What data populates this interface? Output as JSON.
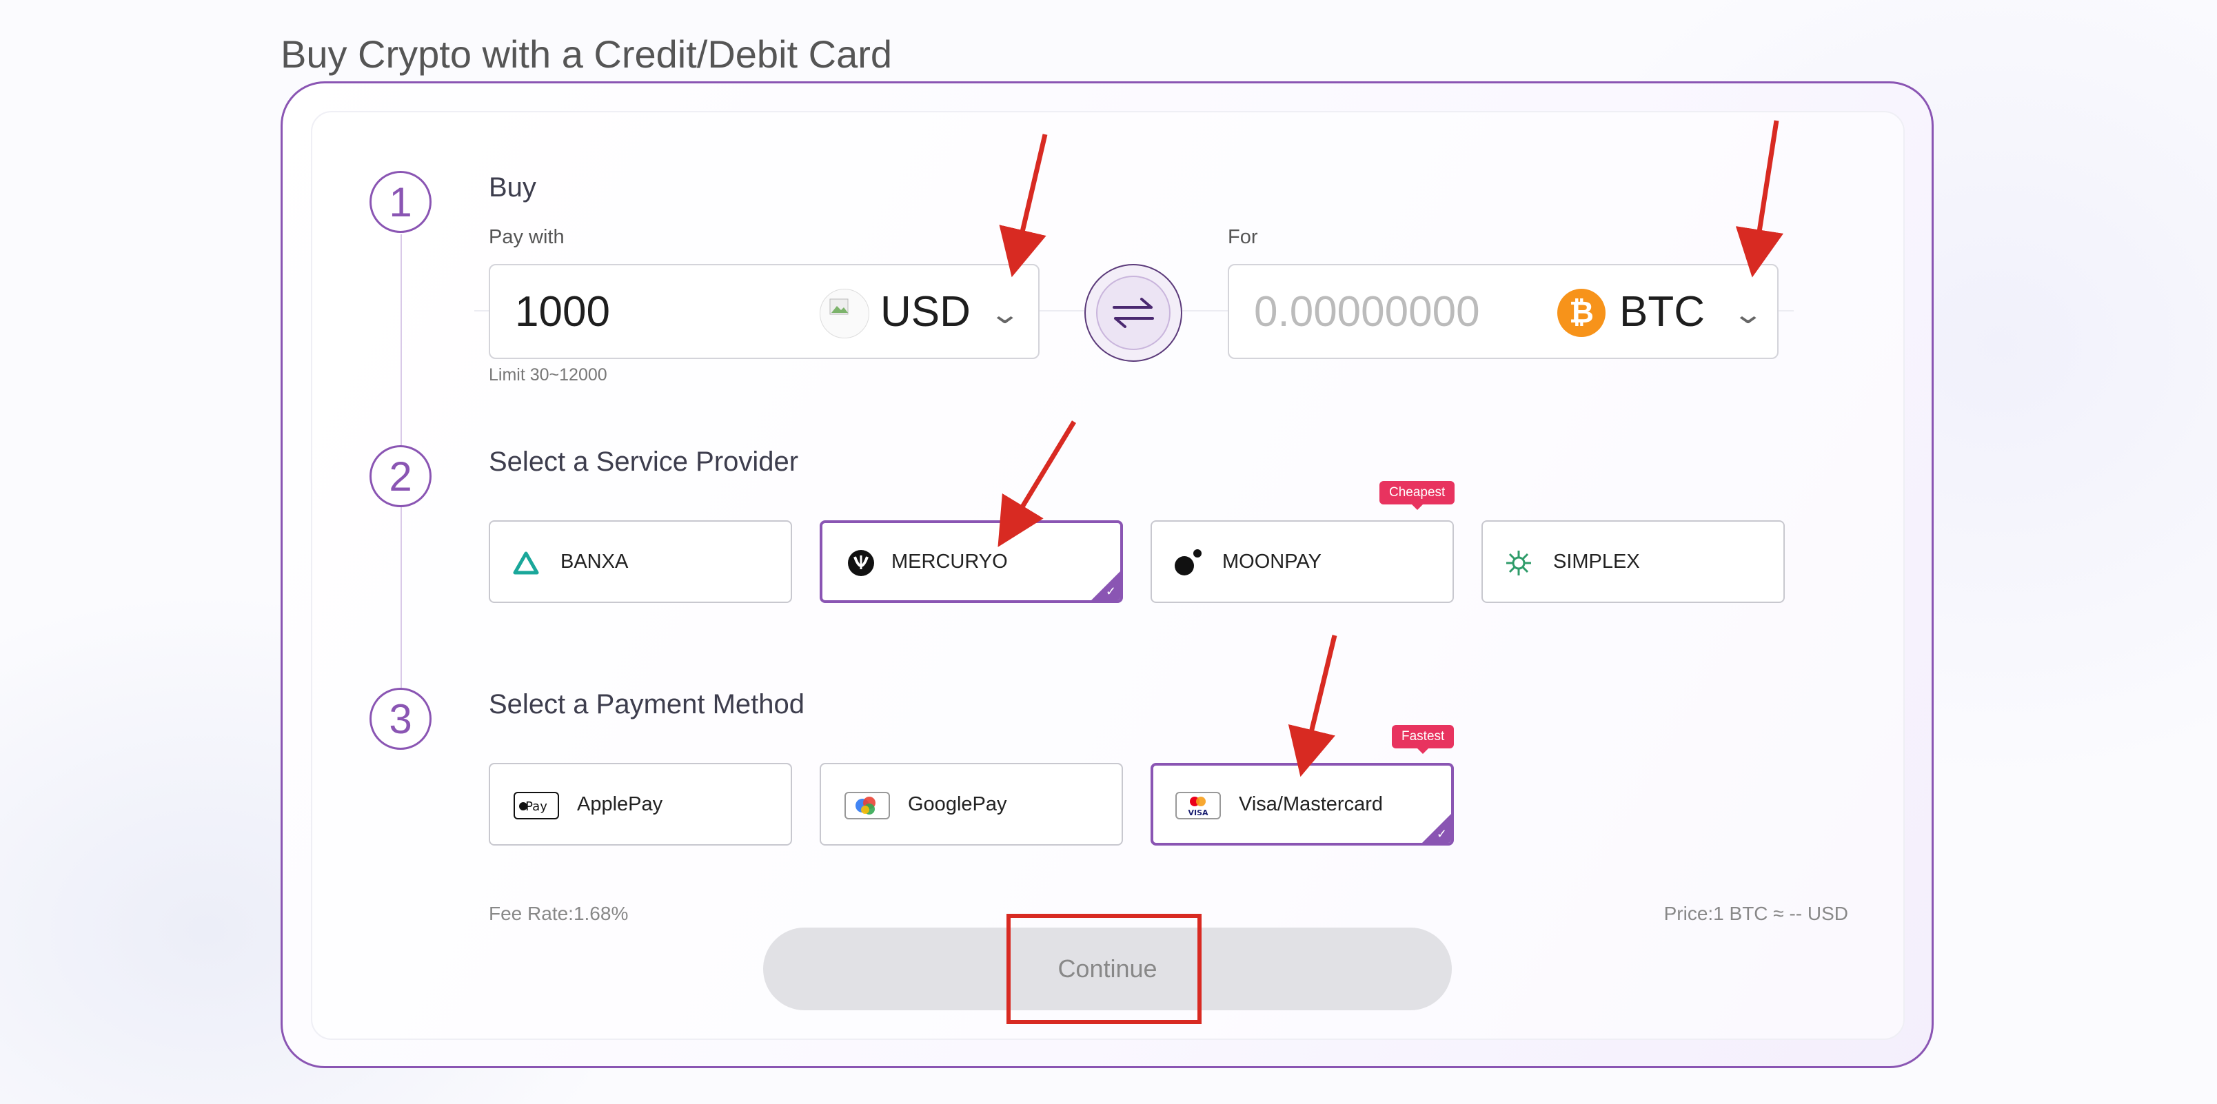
{
  "page": {
    "title": "Buy Crypto with a Credit/Debit Card"
  },
  "steps": [
    "1",
    "2",
    "3"
  ],
  "buy": {
    "title": "Buy",
    "pay_with_label": "Pay with",
    "pay_amount": "1000",
    "pay_currency": "USD",
    "limit": "Limit 30~12000",
    "for_label": "For",
    "receive_placeholder": "0.00000000",
    "receive_currency": "BTC"
  },
  "providers": {
    "title": "Select a Service Provider",
    "items": [
      {
        "label": "BANXA",
        "icon": "banxa-logo-icon",
        "selected": false
      },
      {
        "label": "MERCURYO",
        "icon": "mercuryo-logo-icon",
        "selected": true
      },
      {
        "label": "MOONPAY",
        "icon": "moonpay-logo-icon",
        "selected": false,
        "badge": "Cheapest"
      },
      {
        "label": "SIMPLEX",
        "icon": "simplex-logo-icon",
        "selected": false
      }
    ]
  },
  "payment": {
    "title": "Select a Payment Method",
    "items": [
      {
        "label": "ApplePay",
        "icon": "applepay-icon",
        "selected": false
      },
      {
        "label": "GooglePay",
        "icon": "googlepay-icon",
        "selected": false
      },
      {
        "label": "Visa/Mastercard",
        "icon": "visa-mastercard-icon",
        "selected": true,
        "badge": "Fastest"
      }
    ]
  },
  "footer": {
    "fee_rate": "Fee Rate:1.68%",
    "price": "Price:1 BTC ≈ -- USD",
    "continue_label": "Continue"
  },
  "colors": {
    "accent": "#8a55b3",
    "badge": "#e8335f",
    "annotation": "#d82a22",
    "btc": "#f7931a"
  }
}
